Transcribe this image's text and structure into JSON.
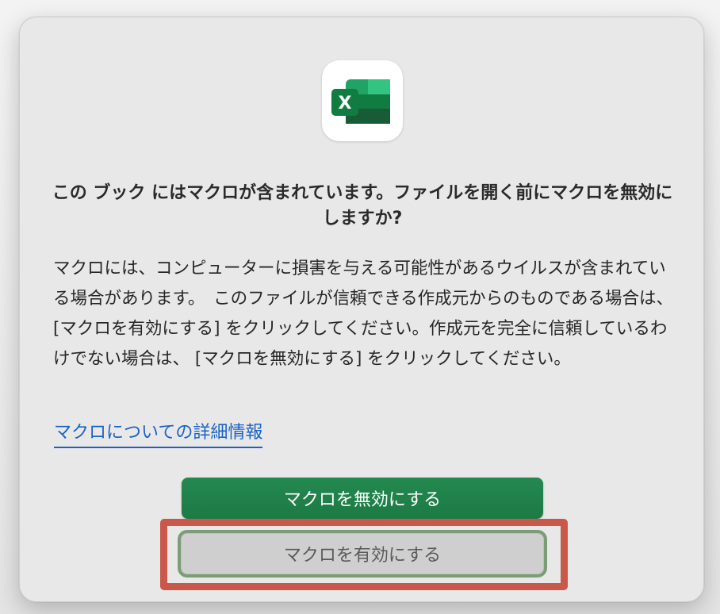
{
  "dialog": {
    "title": "この ブック にはマクロが含まれています。ファイルを開く前にマクロを無効にしますか?",
    "message": "マクロには、コンピューターに損害を与える可能性があるウイルスが含まれている場合があります。　このファイルが信頼できる作成元からのものである場合は、[マクロを有効にする] をクリックしてください。作成元を完全に信頼しているわけでない場合は、 [マクロを無効にする] をクリックしてください。",
    "link_label": "マクロについての詳細情報",
    "primary_button_label": "マクロを無効にする",
    "secondary_button_label": "マクロを有効にする"
  },
  "icons": {
    "app_icon": "excel-icon"
  },
  "colors": {
    "primary_button": "#1f7f48",
    "link": "#1a62c4",
    "highlight": "#c9574a"
  }
}
